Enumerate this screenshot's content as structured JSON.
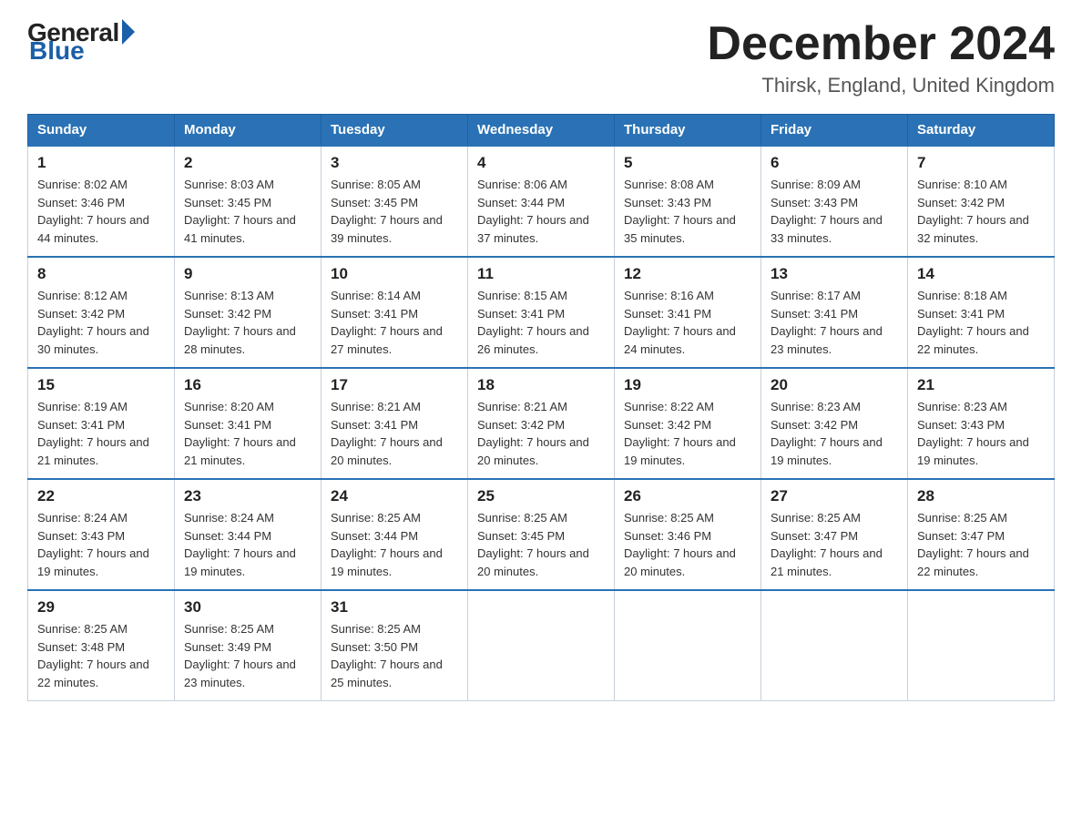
{
  "header": {
    "logo": {
      "general": "General",
      "blue": "Blue"
    },
    "title": "December 2024",
    "subtitle": "Thirsk, England, United Kingdom"
  },
  "calendar": {
    "days_of_week": [
      "Sunday",
      "Monday",
      "Tuesday",
      "Wednesday",
      "Thursday",
      "Friday",
      "Saturday"
    ],
    "weeks": [
      [
        {
          "day": 1,
          "sunrise": "8:02 AM",
          "sunset": "3:46 PM",
          "daylight": "7 hours and 44 minutes."
        },
        {
          "day": 2,
          "sunrise": "8:03 AM",
          "sunset": "3:45 PM",
          "daylight": "7 hours and 41 minutes."
        },
        {
          "day": 3,
          "sunrise": "8:05 AM",
          "sunset": "3:45 PM",
          "daylight": "7 hours and 39 minutes."
        },
        {
          "day": 4,
          "sunrise": "8:06 AM",
          "sunset": "3:44 PM",
          "daylight": "7 hours and 37 minutes."
        },
        {
          "day": 5,
          "sunrise": "8:08 AM",
          "sunset": "3:43 PM",
          "daylight": "7 hours and 35 minutes."
        },
        {
          "day": 6,
          "sunrise": "8:09 AM",
          "sunset": "3:43 PM",
          "daylight": "7 hours and 33 minutes."
        },
        {
          "day": 7,
          "sunrise": "8:10 AM",
          "sunset": "3:42 PM",
          "daylight": "7 hours and 32 minutes."
        }
      ],
      [
        {
          "day": 8,
          "sunrise": "8:12 AM",
          "sunset": "3:42 PM",
          "daylight": "7 hours and 30 minutes."
        },
        {
          "day": 9,
          "sunrise": "8:13 AM",
          "sunset": "3:42 PM",
          "daylight": "7 hours and 28 minutes."
        },
        {
          "day": 10,
          "sunrise": "8:14 AM",
          "sunset": "3:41 PM",
          "daylight": "7 hours and 27 minutes."
        },
        {
          "day": 11,
          "sunrise": "8:15 AM",
          "sunset": "3:41 PM",
          "daylight": "7 hours and 26 minutes."
        },
        {
          "day": 12,
          "sunrise": "8:16 AM",
          "sunset": "3:41 PM",
          "daylight": "7 hours and 24 minutes."
        },
        {
          "day": 13,
          "sunrise": "8:17 AM",
          "sunset": "3:41 PM",
          "daylight": "7 hours and 23 minutes."
        },
        {
          "day": 14,
          "sunrise": "8:18 AM",
          "sunset": "3:41 PM",
          "daylight": "7 hours and 22 minutes."
        }
      ],
      [
        {
          "day": 15,
          "sunrise": "8:19 AM",
          "sunset": "3:41 PM",
          "daylight": "7 hours and 21 minutes."
        },
        {
          "day": 16,
          "sunrise": "8:20 AM",
          "sunset": "3:41 PM",
          "daylight": "7 hours and 21 minutes."
        },
        {
          "day": 17,
          "sunrise": "8:21 AM",
          "sunset": "3:41 PM",
          "daylight": "7 hours and 20 minutes."
        },
        {
          "day": 18,
          "sunrise": "8:21 AM",
          "sunset": "3:42 PM",
          "daylight": "7 hours and 20 minutes."
        },
        {
          "day": 19,
          "sunrise": "8:22 AM",
          "sunset": "3:42 PM",
          "daylight": "7 hours and 19 minutes."
        },
        {
          "day": 20,
          "sunrise": "8:23 AM",
          "sunset": "3:42 PM",
          "daylight": "7 hours and 19 minutes."
        },
        {
          "day": 21,
          "sunrise": "8:23 AM",
          "sunset": "3:43 PM",
          "daylight": "7 hours and 19 minutes."
        }
      ],
      [
        {
          "day": 22,
          "sunrise": "8:24 AM",
          "sunset": "3:43 PM",
          "daylight": "7 hours and 19 minutes."
        },
        {
          "day": 23,
          "sunrise": "8:24 AM",
          "sunset": "3:44 PM",
          "daylight": "7 hours and 19 minutes."
        },
        {
          "day": 24,
          "sunrise": "8:25 AM",
          "sunset": "3:44 PM",
          "daylight": "7 hours and 19 minutes."
        },
        {
          "day": 25,
          "sunrise": "8:25 AM",
          "sunset": "3:45 PM",
          "daylight": "7 hours and 20 minutes."
        },
        {
          "day": 26,
          "sunrise": "8:25 AM",
          "sunset": "3:46 PM",
          "daylight": "7 hours and 20 minutes."
        },
        {
          "day": 27,
          "sunrise": "8:25 AM",
          "sunset": "3:47 PM",
          "daylight": "7 hours and 21 minutes."
        },
        {
          "day": 28,
          "sunrise": "8:25 AM",
          "sunset": "3:47 PM",
          "daylight": "7 hours and 22 minutes."
        }
      ],
      [
        {
          "day": 29,
          "sunrise": "8:25 AM",
          "sunset": "3:48 PM",
          "daylight": "7 hours and 22 minutes."
        },
        {
          "day": 30,
          "sunrise": "8:25 AM",
          "sunset": "3:49 PM",
          "daylight": "7 hours and 23 minutes."
        },
        {
          "day": 31,
          "sunrise": "8:25 AM",
          "sunset": "3:50 PM",
          "daylight": "7 hours and 25 minutes."
        },
        null,
        null,
        null,
        null
      ]
    ]
  }
}
